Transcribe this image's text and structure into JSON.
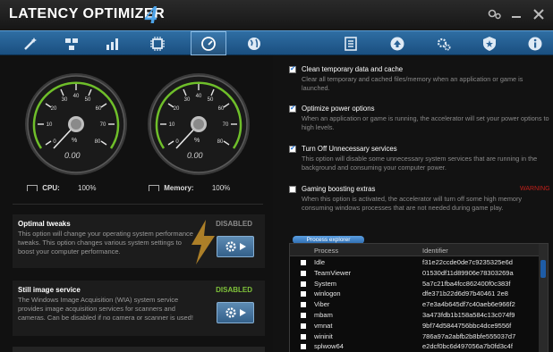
{
  "app": {
    "title": "LATENCY OPTIMIZER",
    "version": "4"
  },
  "toolbar": {
    "items": [
      {
        "icon": "magic-wand-icon"
      },
      {
        "icon": "network-icon"
      },
      {
        "icon": "chart-icon"
      },
      {
        "icon": "chip-icon"
      },
      {
        "icon": "speedometer-icon",
        "active": true
      },
      {
        "icon": "globe-icon"
      },
      {
        "icon": "document-list-icon"
      },
      {
        "icon": "upload-icon"
      },
      {
        "icon": "gears-icon"
      },
      {
        "icon": "shield-icon"
      },
      {
        "icon": "info-icon"
      }
    ]
  },
  "gauges": {
    "cpu": {
      "percent_symbol": "%",
      "readout": "0.00",
      "label": "CPU:",
      "value": "100%"
    },
    "memory": {
      "percent_symbol": "%",
      "readout": "0.00",
      "label": "Memory:",
      "value": "100%"
    }
  },
  "tweaks": [
    {
      "title": "Optimal tweaks",
      "status": "DISABLED",
      "description": "This option will change your operating system performance tweaks. This option changes various system settings to boost your computer performance."
    },
    {
      "title": "Still image service",
      "status": "DISABLED",
      "description": "The Windows Image Acquisition (WIA) system service provides image acquisition services for scanners and cameras. Can be disabled if no camera or scanner is used!"
    }
  ],
  "options": [
    {
      "label": "Clean temporary data and cache",
      "checked": true,
      "description": "Clear all temporary and cached files/memory when an application or game is launched."
    },
    {
      "label": "Optimize power options",
      "checked": true,
      "description": "When an application or game is running, the accelerator will set your power options to high levels."
    },
    {
      "label": "Turn Off Unnecessary services",
      "checked": true,
      "description": "This option will disable some unnecessary system services that are running in the background and consuming your computer power."
    },
    {
      "label": "Gaming boosting extras",
      "checked": false,
      "warning": "WARNING",
      "description": "When this option is activated, the accelerator will turn off some high memory consuming windows processes that are not needed during game play."
    }
  ],
  "process_explorer": {
    "button": "Process explorer",
    "columns": [
      "Process",
      "Identifier"
    ],
    "rows": [
      {
        "name": "Idle",
        "id": "f31e22ccde0de7c9235325e6d"
      },
      {
        "name": "TeamViewer",
        "id": "01530df11d89906e78303269a"
      },
      {
        "name": "System",
        "id": "5a7c21fba4fcc862400f0c383f"
      },
      {
        "name": "winlogon",
        "id": "dfe371b22d6d97b40461 2e8"
      },
      {
        "name": "Viber",
        "id": "e7e3a4b645df7c40aeb6e966f2"
      },
      {
        "name": "mbam",
        "id": "3a473fdb1b158a584c13c074f9"
      },
      {
        "name": "vmnat",
        "id": "9bf74d5844756bbc4dce9556f"
      },
      {
        "name": "wininit",
        "id": "786a97a2abfb2b8bfe555037d7"
      },
      {
        "name": "splwow64",
        "id": "e2dcf0bc6d497056a7b0fd3c4f"
      }
    ]
  }
}
